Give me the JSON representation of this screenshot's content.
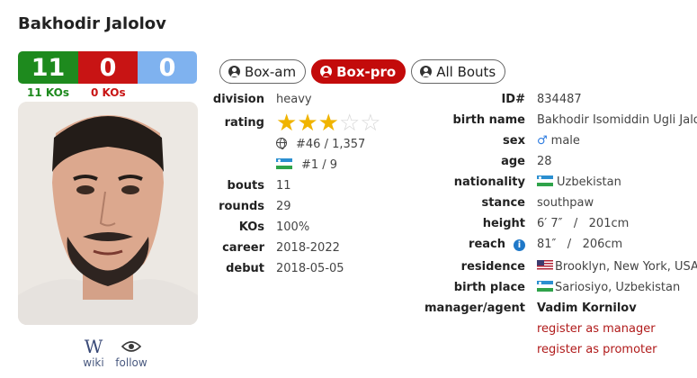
{
  "boxer": {
    "name": "Bakhodir Jalolov"
  },
  "record": {
    "wins": "11",
    "losses": "0",
    "draws": "0",
    "win_kos": "11 KOs",
    "loss_kos": "0 KOs"
  },
  "colors": {
    "win": "#1e8a1e",
    "loss": "#c81414",
    "draw": "#7fb2ef",
    "accent": "#c30b0b",
    "star": "#f0b400"
  },
  "links": {
    "wiki": "wiki",
    "follow": "follow",
    "wiki_glyph": "W",
    "follow_icon": "eye-icon"
  },
  "tabs": [
    {
      "label": "Box-am",
      "active": false
    },
    {
      "label": "Box-pro",
      "active": true
    },
    {
      "label": "All Bouts",
      "active": false
    }
  ],
  "left": {
    "division": {
      "label": "division",
      "value": "heavy"
    },
    "rating": {
      "label": "rating",
      "stars": 3,
      "max_stars": 5,
      "world_rank": "#46 / 1,357",
      "country_rank": "#1 / 9"
    },
    "bouts": {
      "label": "bouts",
      "value": "11"
    },
    "rounds": {
      "label": "rounds",
      "value": "29"
    },
    "kos": {
      "label": "KOs",
      "value": "100%"
    },
    "career": {
      "label": "career",
      "value": "2018-2022"
    },
    "debut": {
      "label": "debut",
      "value": "2018-05-05"
    }
  },
  "right": {
    "id": {
      "label": "ID#",
      "value": "834487"
    },
    "birth_name": {
      "label": "birth name",
      "value": "Bakhodir Isomiddin Ugli Jalo"
    },
    "sex": {
      "label": "sex",
      "value": "male"
    },
    "age": {
      "label": "age",
      "value": "28"
    },
    "nationality": {
      "label": "nationality",
      "value": "Uzbekistan"
    },
    "stance": {
      "label": "stance",
      "value": "southpaw"
    },
    "height": {
      "label": "height",
      "value": "6′ 7″   /   201cm"
    },
    "reach": {
      "label": "reach",
      "value": "81″   /   206cm"
    },
    "residence": {
      "label": "residence",
      "value": "Brooklyn, New York, USA"
    },
    "birth_place": {
      "label": "birth place",
      "value": "Sariosiyo, Uzbekistan"
    },
    "manager": {
      "label": "manager/agent",
      "value": "Vadim Kornilov"
    },
    "register_manager": "register as manager",
    "register_promoter": "register as promoter"
  }
}
